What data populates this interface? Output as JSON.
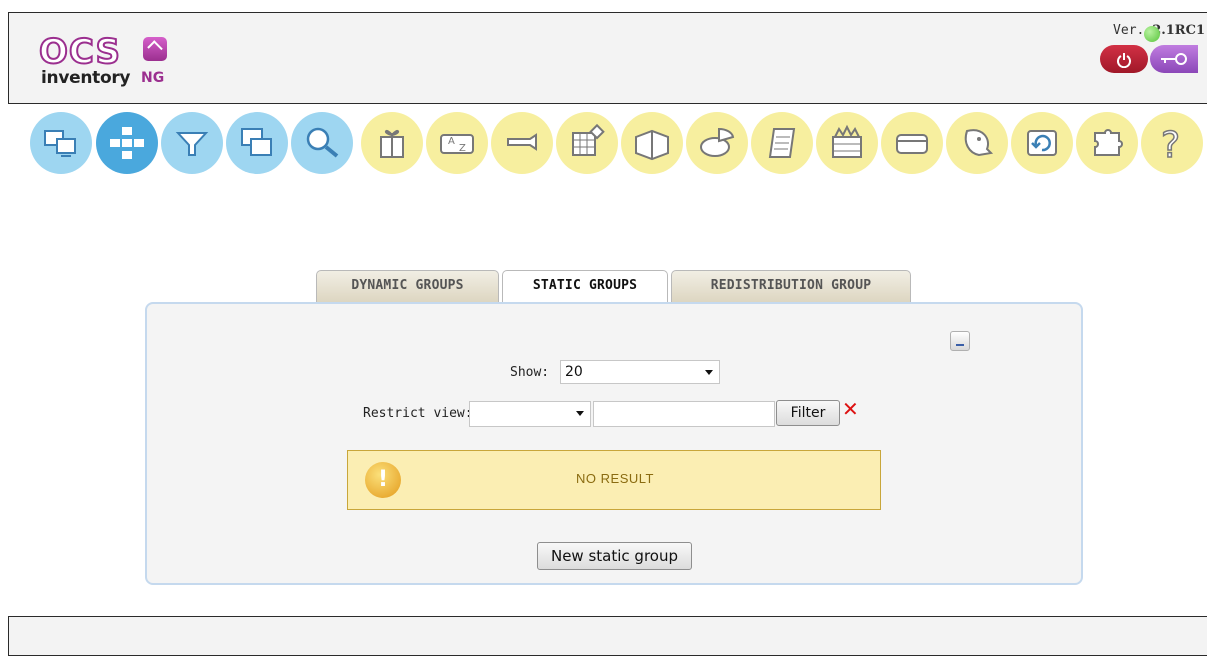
{
  "header": {
    "logo": {
      "brand": "OCS",
      "product": "inventory",
      "suffix": "NG"
    },
    "version_prefix": "Ver.",
    "version": "2.1RC1",
    "status_color": "#57c43a",
    "logout_icon": "power-icon",
    "key_icon": "key-icon"
  },
  "toolbar": {
    "items": [
      {
        "icon": "computers-icon",
        "color": "blue"
      },
      {
        "icon": "network-icon",
        "color": "blue",
        "active": true
      },
      {
        "icon": "filter-icon",
        "color": "blue"
      },
      {
        "icon": "windows-icon",
        "color": "blue"
      },
      {
        "icon": "search-icon",
        "color": "blue"
      },
      {
        "icon": "gift-icon",
        "color": "yellow"
      },
      {
        "icon": "sort-az-icon",
        "color": "yellow"
      },
      {
        "icon": "wrench-icon",
        "color": "yellow"
      },
      {
        "icon": "table-icon",
        "color": "yellow"
      },
      {
        "icon": "book-icon",
        "color": "yellow"
      },
      {
        "icon": "pie-chart-icon",
        "color": "yellow"
      },
      {
        "icon": "document-icon",
        "color": "yellow"
      },
      {
        "icon": "firewall-icon",
        "color": "yellow"
      },
      {
        "icon": "card-icon",
        "color": "yellow"
      },
      {
        "icon": "user-icon",
        "color": "yellow"
      },
      {
        "icon": "restore-icon",
        "color": "yellow"
      },
      {
        "icon": "puzzle-icon",
        "color": "yellow"
      },
      {
        "icon": "help-icon",
        "color": "yellow"
      }
    ]
  },
  "tabs": [
    {
      "label": "DYNAMIC GROUPS",
      "active": false
    },
    {
      "label": "STATIC GROUPS",
      "active": true
    },
    {
      "label": "REDISTRIBUTION GROUP",
      "active": false
    }
  ],
  "panel": {
    "show_label": "Show:",
    "show_value": "20",
    "restrict_label": "Restrict view:",
    "restrict_select_value": "",
    "restrict_input_value": "",
    "filter_button": "Filter",
    "no_result": "NO RESULT",
    "new_group_button": "New static group"
  },
  "colors": {
    "brand": "#9b2f8f",
    "tool_blue": "#9ed6f1",
    "tool_yellow": "#f7ef9f",
    "panel_border": "#c5d9ee",
    "warning_bg": "#fbeeb3"
  }
}
